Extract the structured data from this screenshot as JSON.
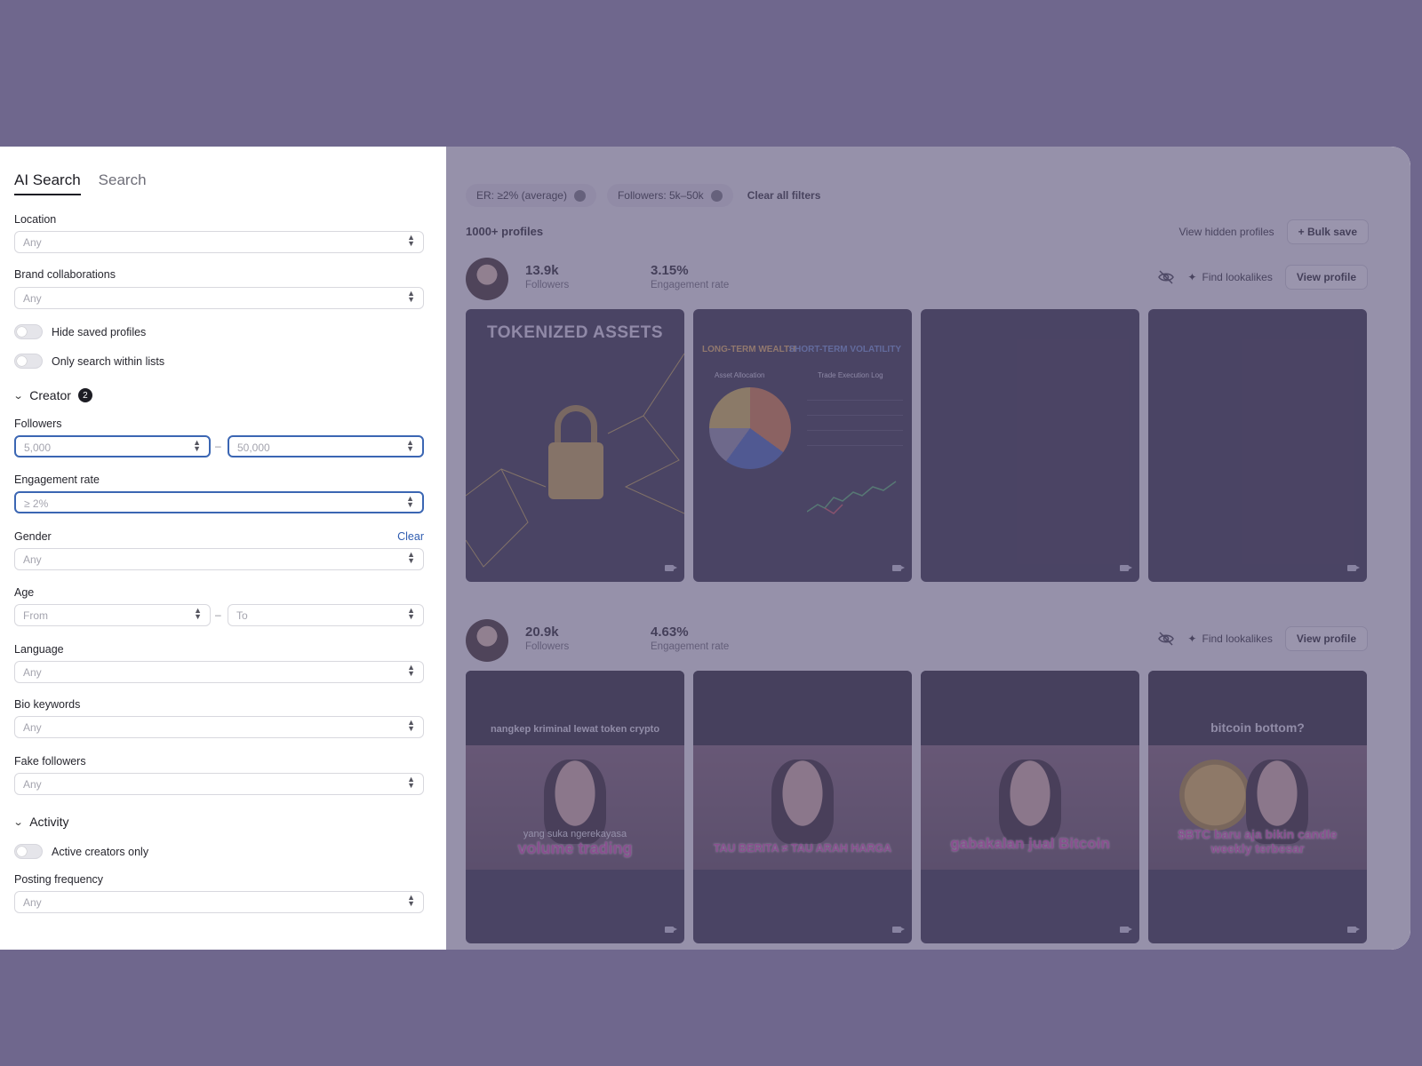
{
  "sidebar": {
    "tabs": [
      {
        "label": "AI Search",
        "active": true
      },
      {
        "label": "Search",
        "active": false
      }
    ],
    "location": {
      "label": "Location",
      "value": "Any"
    },
    "brand_collaborations": {
      "label": "Brand collaborations",
      "value": "Any"
    },
    "hide_saved": {
      "label": "Hide saved profiles",
      "on": false
    },
    "only_lists": {
      "label": "Only search within lists",
      "on": false
    },
    "creator_section": {
      "label": "Creator",
      "badge": "2"
    },
    "followers": {
      "label": "Followers",
      "from": "5,000",
      "to": "50,000",
      "separator": "–"
    },
    "engagement_rate": {
      "label": "Engagement rate",
      "value": "≥ 2%"
    },
    "gender": {
      "label": "Gender",
      "value": "Any",
      "clear": "Clear"
    },
    "age": {
      "label": "Age",
      "from": "From",
      "to": "To",
      "separator": "–"
    },
    "language": {
      "label": "Language",
      "value": "Any"
    },
    "bio_keywords": {
      "label": "Bio keywords",
      "value": "Any"
    },
    "fake_followers": {
      "label": "Fake followers",
      "value": "Any"
    },
    "activity_section": {
      "label": "Activity"
    },
    "active_only": {
      "label": "Active creators only",
      "on": false
    },
    "posting_frequency": {
      "label": "Posting frequency",
      "value": "Any"
    }
  },
  "results": {
    "chips": [
      {
        "label": "ER: ≥2% (average)"
      },
      {
        "label": "Followers: 5k–50k"
      }
    ],
    "clear_all": "Clear all filters",
    "count": "1000+ profiles",
    "view_hidden": "View hidden profiles",
    "bulk_save": "+ Bulk save",
    "profiles": [
      {
        "followers": "13.9k",
        "followers_label": "Followers",
        "engagement": "3.15%",
        "engagement_label": "Engagement rate",
        "find_lookalikes": "Find lookalikes",
        "view_profile": "View profile",
        "posts": [
          {
            "caption": "TOKENIZED ASSETS"
          },
          {
            "caption_left": "LONG-TERM WEALTH",
            "caption_right": "SHORT-TERM VOLATILITY",
            "sub_left": "Asset Allocation",
            "sub_right": "Trade Execution Log"
          },
          {},
          {}
        ]
      },
      {
        "followers": "20.9k",
        "followers_label": "Followers",
        "engagement": "4.63%",
        "engagement_label": "Engagement rate",
        "find_lookalikes": "Find lookalikes",
        "view_profile": "View profile",
        "posts": [
          {
            "caption": "nangkep kriminal lewat token crypto",
            "sub_small": "yang suka ngerekayasa",
            "sub_big": "volume trading"
          },
          {
            "sub_big": "TAU BERITA ≠ TAU ARAH HARGA"
          },
          {
            "sub_big": "gabakalan jual Bitcoin"
          },
          {
            "caption": "bitcoin bottom?",
            "sub_big": "$BTC baru aja bikin candle weekly terbesar"
          }
        ]
      }
    ]
  },
  "colors": {
    "backdrop": "#6f678d",
    "focus_border": "#3b66b3",
    "link": "#2f5cb0",
    "overlay": "#5c547a"
  }
}
